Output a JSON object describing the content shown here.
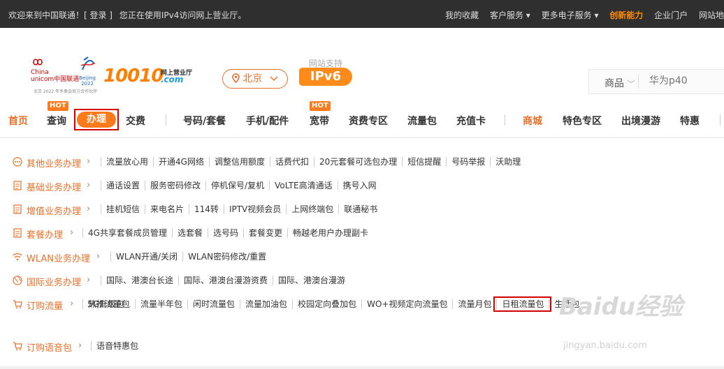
{
  "topbar": {
    "welcome": "欢迎来到中国联通！[ 登录 ]",
    "ipv4_notice": "您正在使用IPv4访问网上营业厅。",
    "links": [
      "我的收藏",
      "客户服务 ▾",
      "更多电子服务 ▾",
      "创新能力",
      "企业门户",
      "网站地"
    ]
  },
  "logo": {
    "unicom_line1": "China",
    "unicom_line2": "unicom中国联通",
    "olympic": "Beijing 2022",
    "number": "10010",
    "sub1": "网上营业厅",
    "sub2": ".com",
    "tiny": "北京 2022 年冬奥会官方合作伙伴"
  },
  "city": {
    "label": "北京"
  },
  "ipv6": {
    "caption": "网站支持",
    "label": "IPv6"
  },
  "search": {
    "category": "商品",
    "placeholder": "华为p40"
  },
  "nav": {
    "items": [
      "首页",
      "查询",
      "办理",
      "交费",
      "号码/套餐",
      "手机/配件",
      "宽带",
      "资费专区",
      "流量包",
      "充值卡",
      "商城",
      "特色专区",
      "出境漫游",
      "特惠"
    ],
    "hot_label": "HOT"
  },
  "categories": [
    {
      "name": "其他业务办理",
      "links": [
        "流量放心用",
        "开通4G网络",
        "调整信用额度",
        "话费代扣",
        "20元套餐可选包办理",
        "短信提醒",
        "号码举报",
        "沃助理"
      ]
    },
    {
      "name": "基础业务办理",
      "links": [
        "通话设置",
        "服务密码修改",
        "停机保号/复机",
        "VoLTE高清通话",
        "携号入网"
      ]
    },
    {
      "name": "增值业务办理",
      "links": [
        "挂机短信",
        "来电名片",
        "114转",
        "IPTV视频会员",
        "上网终端包",
        "联通秘书"
      ]
    },
    {
      "name": "套餐办理",
      "links": [
        "4G共享套餐成员管理",
        "选套餐",
        "选号码",
        "套餐变更",
        "畅越老用户办理副卡"
      ]
    },
    {
      "name": "WLAN业务办理",
      "links": [
        "WLAN开通/关闭",
        "WLAN密码修改/重置"
      ]
    },
    {
      "name": "国际业务办理",
      "links": [
        "国际、港澳台长途",
        "国际、港澳台漫游资费",
        "国际、港澳台漫游"
      ]
    },
    {
      "name": "订购流量",
      "links": [
        "热推流量包",
        "流量半年包",
        "闲时流量包",
        "流量加油包",
        "校园定向叠加包",
        "WO+视频定向流量包",
        "流量月包",
        "日租流量包",
        "生活包"
      ],
      "links2": [
        "5G升级包"
      ]
    },
    {
      "name": "订购语音包",
      "links": [
        "语音特惠包"
      ]
    }
  ],
  "watermark": {
    "brand": "Baidu经验",
    "url": "jingyan.baidu.com"
  },
  "colors": {
    "accent": "#e8702a",
    "highlight_box": "#d40000",
    "topbar_bg": "#2f2f2f"
  }
}
